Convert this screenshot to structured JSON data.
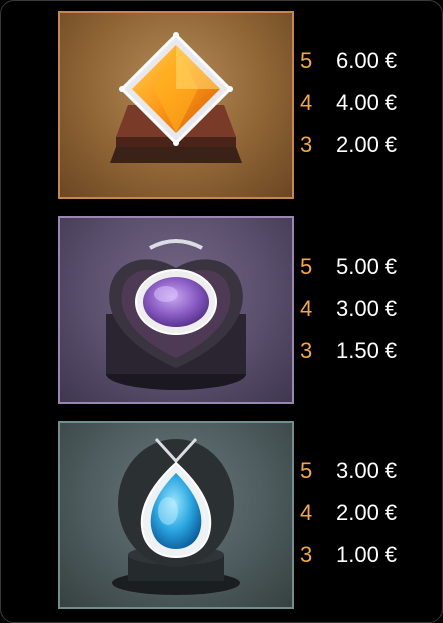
{
  "symbols": [
    {
      "name": "orange-gem",
      "pays": [
        {
          "count": "5",
          "amount": "6.00 €"
        },
        {
          "count": "4",
          "amount": "4.00 €"
        },
        {
          "count": "3",
          "amount": "2.00 €"
        }
      ]
    },
    {
      "name": "purple-gem",
      "pays": [
        {
          "count": "5",
          "amount": "5.00 €"
        },
        {
          "count": "4",
          "amount": "3.00 €"
        },
        {
          "count": "3",
          "amount": "1.50 €"
        }
      ]
    },
    {
      "name": "blue-gem",
      "pays": [
        {
          "count": "5",
          "amount": "3.00 €"
        },
        {
          "count": "4",
          "amount": "2.00 €"
        },
        {
          "count": "3",
          "amount": "1.00 €"
        }
      ]
    }
  ],
  "colors": {
    "count_color": "#f5a93a",
    "amount_color": "#ffffff",
    "background": "#000000"
  }
}
